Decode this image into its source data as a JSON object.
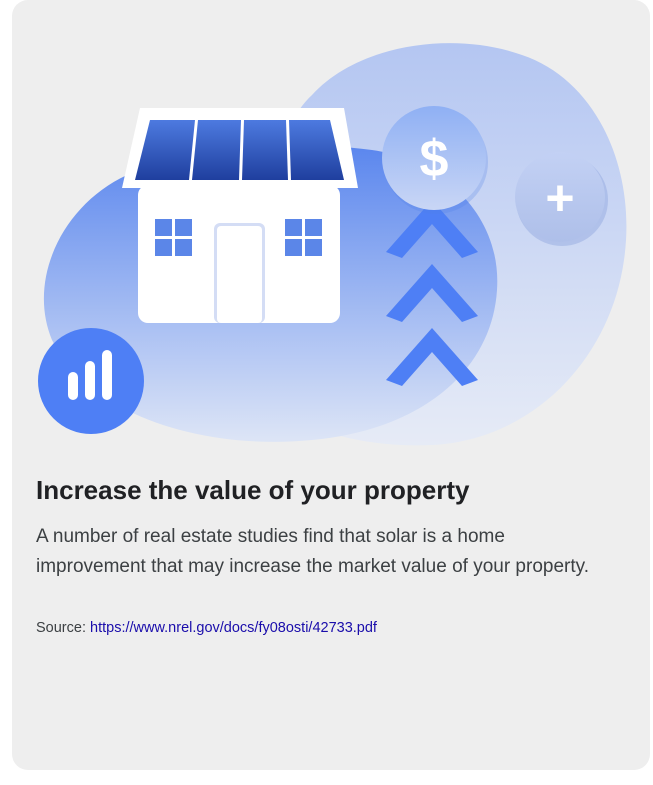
{
  "card": {
    "illustration": {
      "dollar_glyph": "$",
      "plus_glyph": "+"
    },
    "title": "Increase the value of your property",
    "description": "A number of real estate studies find that solar is a home improvement that may increase the market value of your property.",
    "source": {
      "label": "Source:",
      "link_text": "https://www.nrel.gov/docs/fy08osti/42733.pdf"
    }
  },
  "colors": {
    "card_background": "#eeeeee",
    "accent_blue": "#4e7ff5",
    "link": "#1a0dab",
    "title": "#202124",
    "body_text": "#3c4043"
  }
}
